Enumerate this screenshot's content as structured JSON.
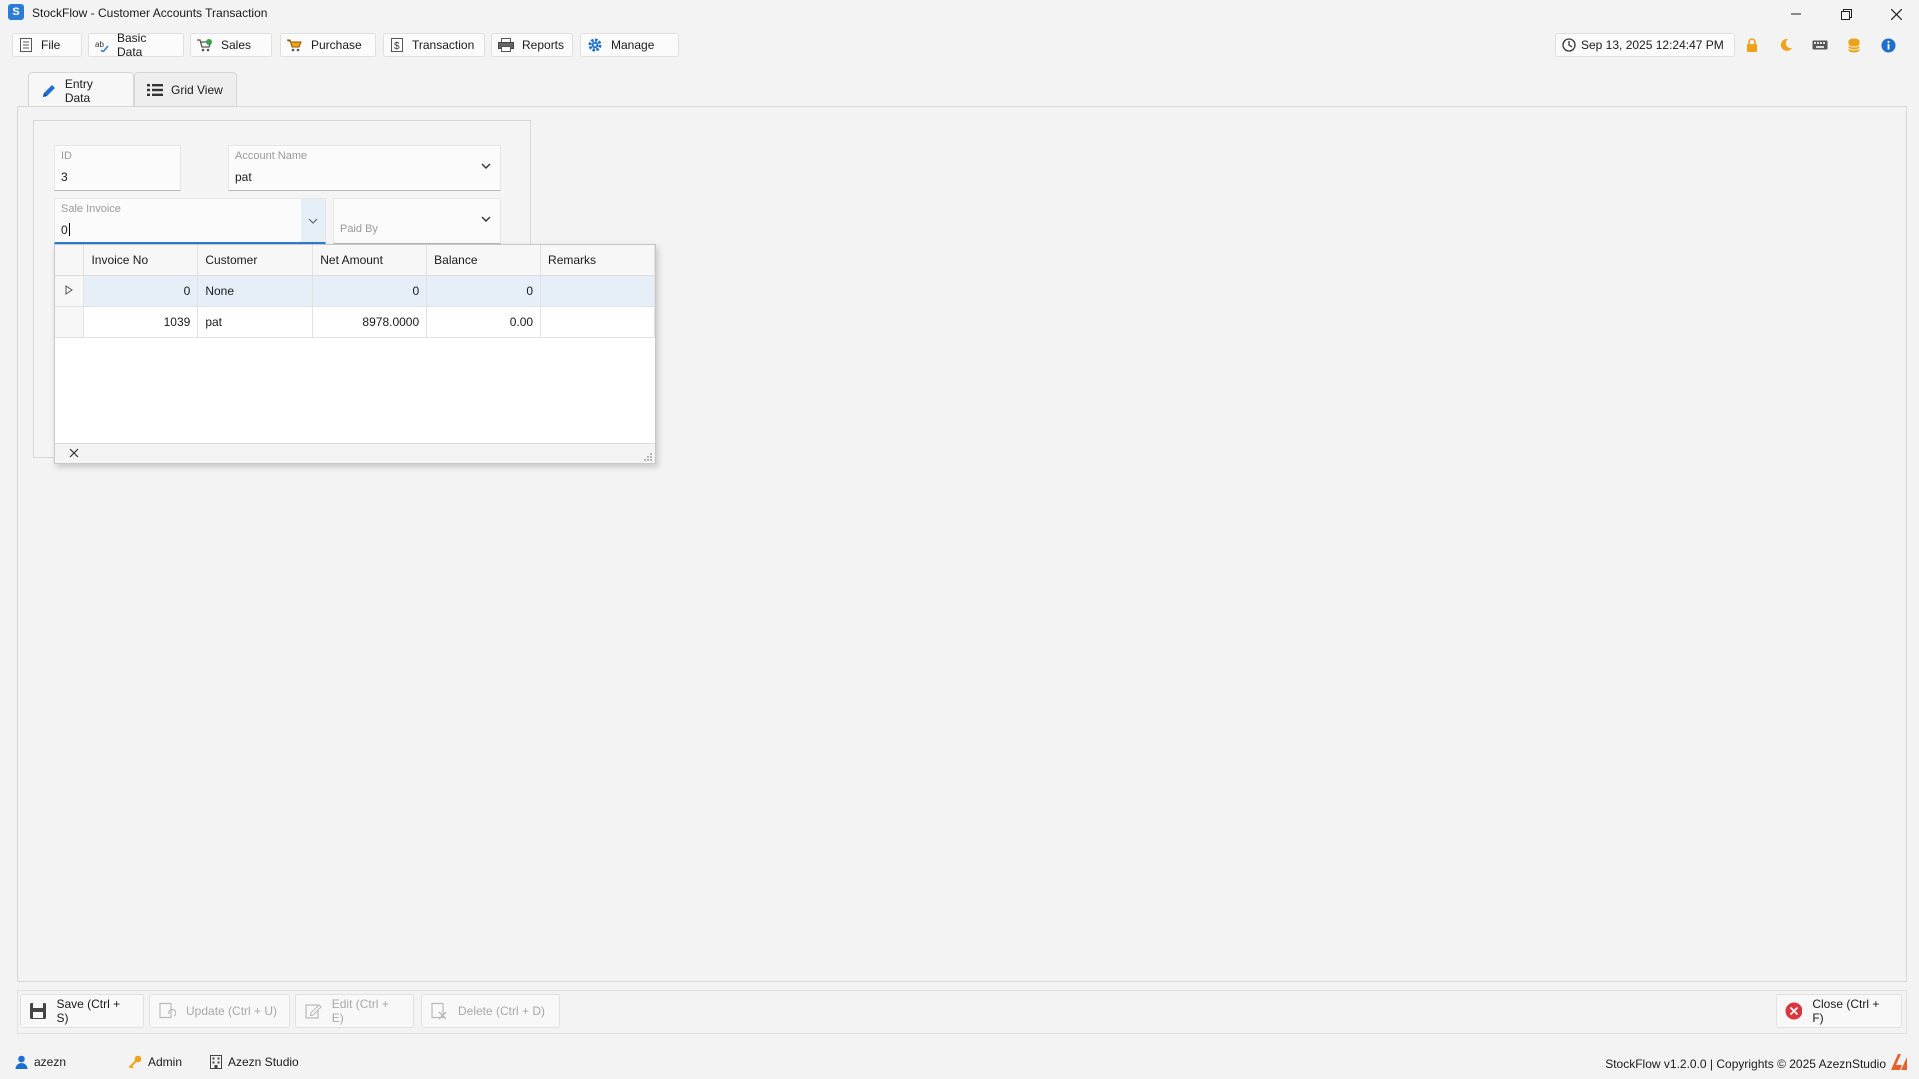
{
  "window": {
    "title": "StockFlow - Customer Accounts Transaction",
    "app_icon_letter": "S"
  },
  "menu": {
    "file": "File",
    "basic_data": "Basic Data",
    "sales": "Sales",
    "purchase": "Purchase",
    "transaction": "Transaction",
    "reports": "Reports",
    "manage": "Manage"
  },
  "header": {
    "datetime": "Sep 13, 2025 12:24:47 PM"
  },
  "tabs": {
    "entry_data": "Entry Data",
    "grid_view": "Grid View"
  },
  "form": {
    "id_label": "ID",
    "id_value": "3",
    "account_name_label": "Account Name",
    "account_name_value": "pat",
    "sale_invoice_label": "Sale Invoice",
    "sale_invoice_value": "0",
    "paid_by_label": "Paid By",
    "paid_by_value": ""
  },
  "dropdown": {
    "columns": [
      "Invoice No",
      "Customer",
      "Net Amount",
      "Balance",
      "Remarks"
    ],
    "rows": [
      {
        "invoice_no": "0",
        "customer": "None",
        "net_amount": "0",
        "balance": "0",
        "remarks": ""
      },
      {
        "invoice_no": "1039",
        "customer": "pat",
        "net_amount": "8978.0000",
        "balance": "0.00",
        "remarks": ""
      }
    ],
    "selected_row": 0
  },
  "actions": {
    "save": "Save (Ctrl + S)",
    "update": "Update (Ctrl + U)",
    "edit": "Edit (Ctrl + E)",
    "delete": "Delete (Ctrl + D)",
    "close": "Close (Ctrl + F)"
  },
  "status": {
    "user": "azezn",
    "role": "Admin",
    "company": "Azezn Studio",
    "copyright": "StockFlow v1.2.0.0 | Copyrights © 2025 AzeznStudio"
  },
  "colors": {
    "accent": "#2b7cd3",
    "lock": "#f0a21a",
    "moon": "#f0a21a",
    "database": "#e8a317",
    "info": "#1e6fd0",
    "close_red": "#d9363e",
    "brand": "#e8602c"
  }
}
